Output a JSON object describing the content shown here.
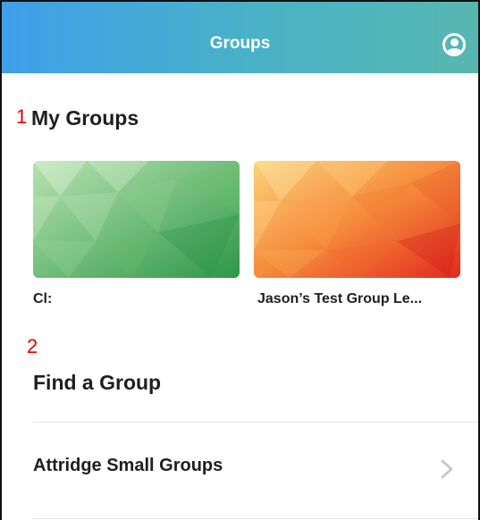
{
  "header": {
    "title": "Groups",
    "profile_icon": "account-circle-icon"
  },
  "annotations": {
    "marker_1": "1",
    "marker_2": "2",
    "color": "#e00000"
  },
  "my_groups": {
    "title": "My Groups",
    "cards": [
      {
        "label": "Cl:",
        "theme": "green",
        "colors": [
          "#a9dca3",
          "#2f9a4b"
        ]
      },
      {
        "label": "Jason’s Test Group Le...",
        "theme": "orange",
        "colors": [
          "#f9c36a",
          "#e8381f"
        ]
      }
    ]
  },
  "find_group": {
    "title": "Find a Group",
    "items": [
      {
        "label": "Attridge Small Groups",
        "icon": "chevron-right-icon"
      }
    ]
  }
}
